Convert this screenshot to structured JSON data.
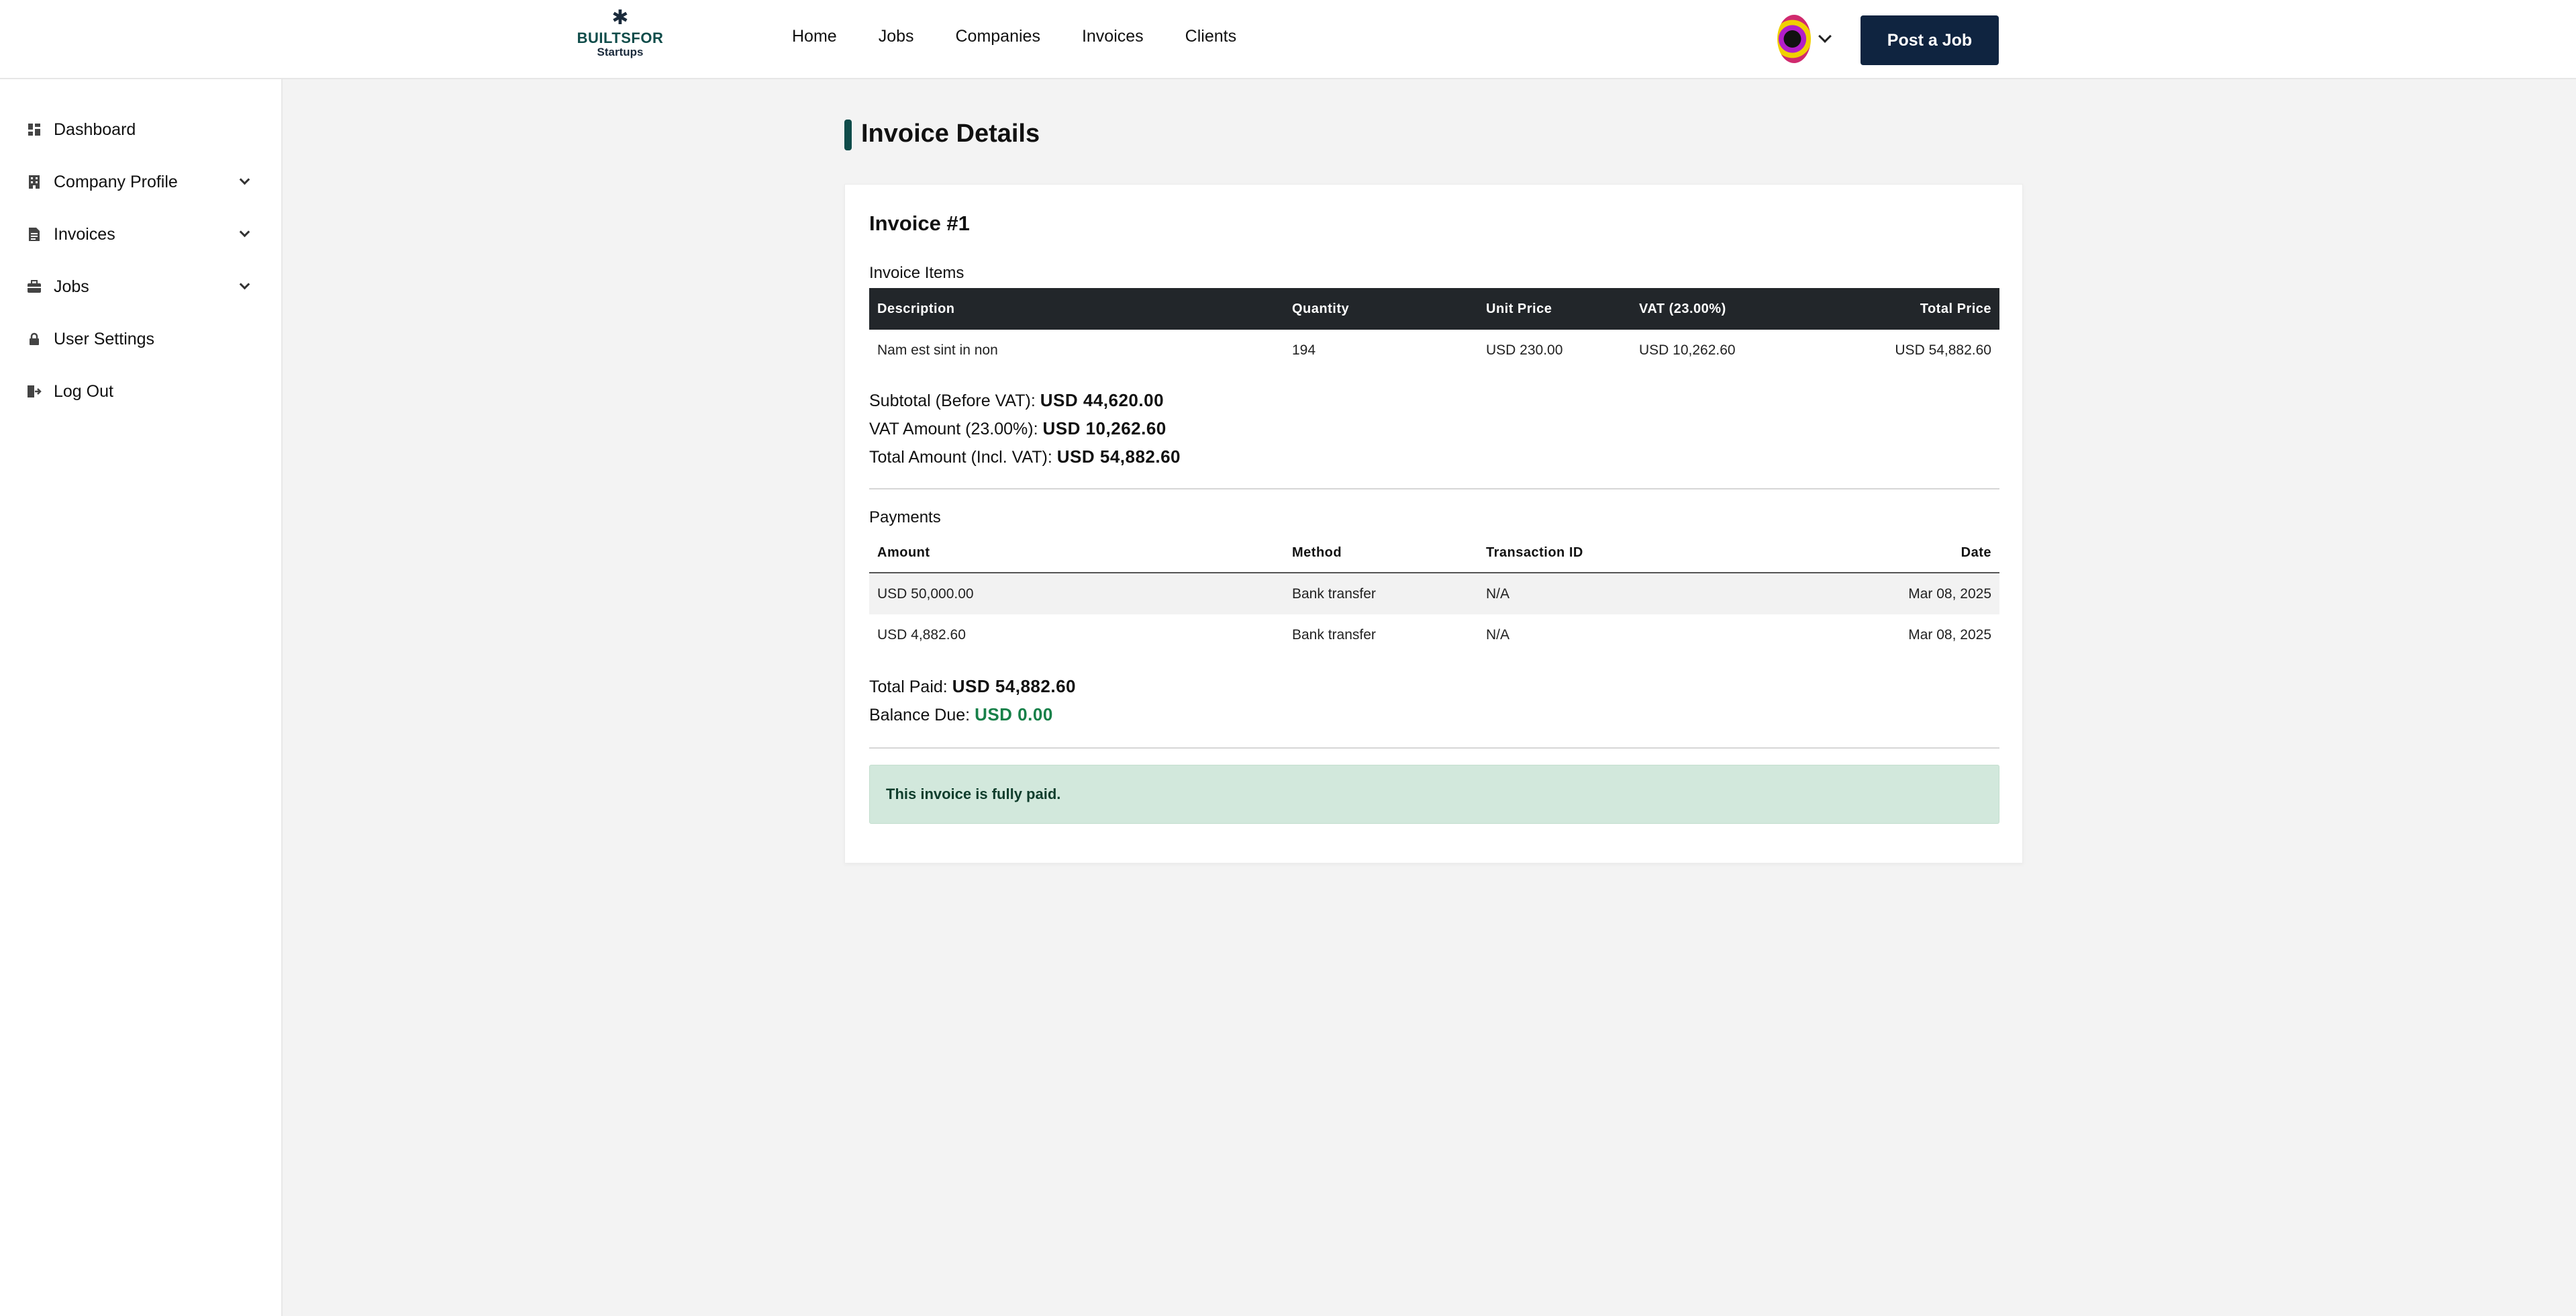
{
  "brand": {
    "line1": "BUILTSFOR",
    "line2": "Startups",
    "mark": "✱"
  },
  "nav": [
    {
      "label": "Home"
    },
    {
      "label": "Jobs"
    },
    {
      "label": "Companies"
    },
    {
      "label": "Invoices"
    },
    {
      "label": "Clients"
    }
  ],
  "header": {
    "post_job_label": "Post a Job",
    "avatar_icon": "user-avatar"
  },
  "sidebar": {
    "items": [
      {
        "label": "Dashboard",
        "icon": "dashboard-icon",
        "expandable": false
      },
      {
        "label": "Company Profile",
        "icon": "building-icon",
        "expandable": true
      },
      {
        "label": "Invoices",
        "icon": "document-icon",
        "expandable": true
      },
      {
        "label": "Jobs",
        "icon": "briefcase-icon",
        "expandable": true
      },
      {
        "label": "User Settings",
        "icon": "lock-icon",
        "expandable": false
      },
      {
        "label": "Log Out",
        "icon": "logout-icon",
        "expandable": false
      }
    ]
  },
  "page": {
    "title": "Invoice Details"
  },
  "invoice": {
    "number": "Invoice #1",
    "items_label": "Invoice Items",
    "items_columns": [
      "Description",
      "Quantity",
      "Unit Price",
      "VAT (23.00%)",
      "Total Price"
    ],
    "items": [
      {
        "description": "Nam est sint in non",
        "quantity": "194",
        "unit_price": "USD 230.00",
        "vat": "USD 10,262.60",
        "total": "USD 54,882.60"
      }
    ],
    "subtotal_label": "Subtotal (Before VAT):",
    "subtotal_value": "USD 44,620.00",
    "vat_label": "VAT Amount (23.00%):",
    "vat_value": "USD 10,262.60",
    "total_label": "Total Amount (Incl. VAT):",
    "total_value": "USD 54,882.60",
    "payments_label": "Payments",
    "payments_columns": [
      "Amount",
      "Method",
      "Transaction ID",
      "Date"
    ],
    "payments": [
      {
        "amount": "USD 50,000.00",
        "method": "Bank transfer",
        "txn": "N/A",
        "date": "Mar 08, 2025"
      },
      {
        "amount": "USD 4,882.60",
        "method": "Bank transfer",
        "txn": "N/A",
        "date": "Mar 08, 2025"
      }
    ],
    "total_paid_label": "Total Paid:",
    "total_paid_value": "USD 54,882.60",
    "balance_label": "Balance Due:",
    "balance_value": "USD 0.00",
    "status_message": "This invoice is fully paid."
  },
  "colors": {
    "brand": "#0f4c4a",
    "navy": "#0f2440",
    "success": "#178049",
    "alert_bg": "#d2e8dc"
  }
}
